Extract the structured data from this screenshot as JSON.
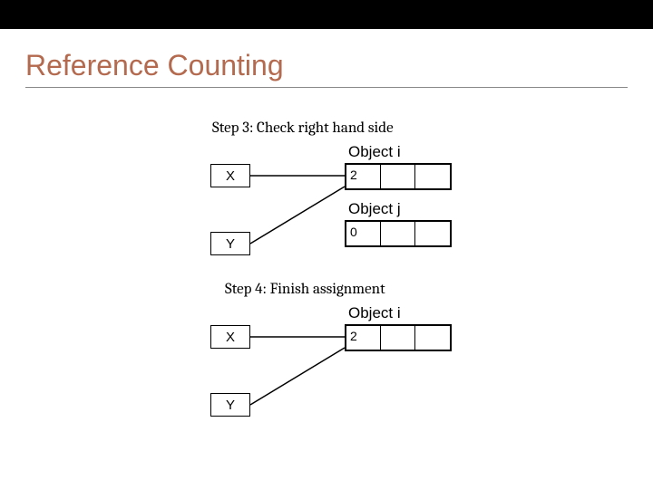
{
  "title": "Reference Counting",
  "steps": {
    "s3": {
      "label": "Step 3: Check right hand side",
      "vars": {
        "x": "X",
        "y": "Y"
      },
      "obj_i": {
        "label": "Object i",
        "refcount": "2"
      },
      "obj_j": {
        "label": "Object j",
        "refcount": "0"
      }
    },
    "s4": {
      "label": "Step 4: Finish assignment",
      "vars": {
        "x": "X",
        "y": "Y"
      },
      "obj_i": {
        "label": "Object i",
        "refcount": "2"
      }
    }
  }
}
